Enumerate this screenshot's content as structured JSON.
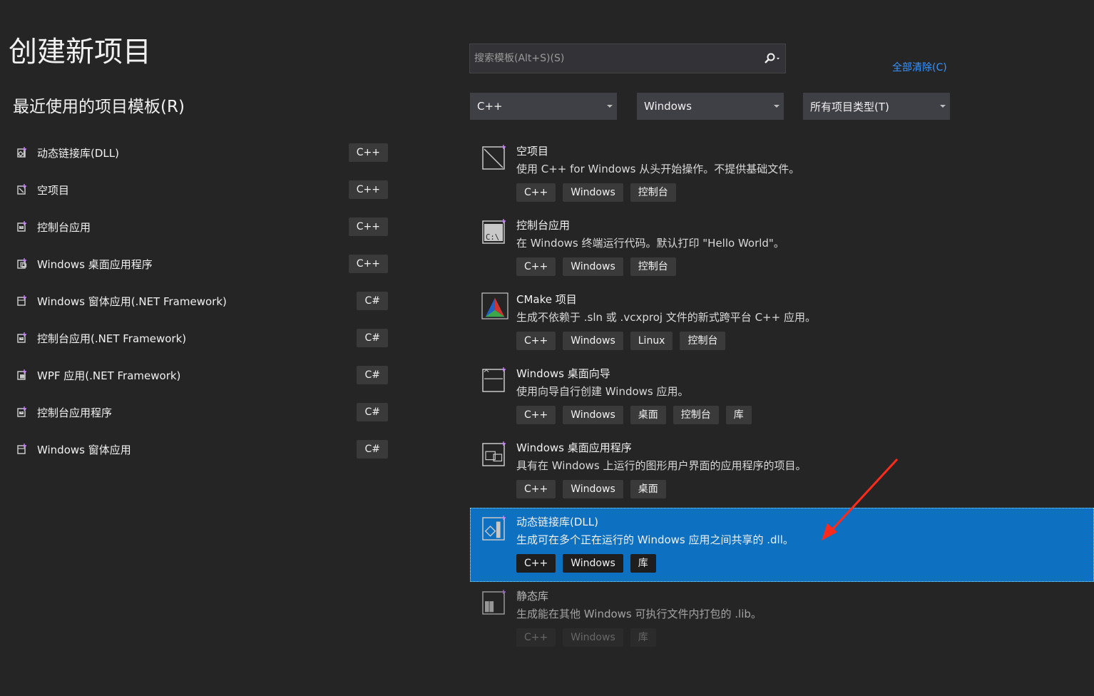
{
  "page": {
    "title": "创建新项目",
    "recent_heading": "最近使用的项目模板(R)"
  },
  "recent": [
    {
      "label": "动态链接库(DLL)",
      "lang": "C++",
      "icon": "dll-icon"
    },
    {
      "label": "空项目",
      "lang": "C++",
      "icon": "empty-project-icon"
    },
    {
      "label": "控制台应用",
      "lang": "C++",
      "icon": "console-app-icon"
    },
    {
      "label": "Windows 桌面应用程序",
      "lang": "C++",
      "icon": "desktop-app-icon"
    },
    {
      "label": "Windows 窗体应用(.NET Framework)",
      "lang": "C#",
      "icon": "winforms-icon"
    },
    {
      "label": "控制台应用(.NET Framework)",
      "lang": "C#",
      "icon": "console-app-icon"
    },
    {
      "label": "WPF 应用(.NET Framework)",
      "lang": "C#",
      "icon": "wpf-icon"
    },
    {
      "label": "控制台应用程序",
      "lang": "C#",
      "icon": "console-app-icon"
    },
    {
      "label": "Windows 窗体应用",
      "lang": "C#",
      "icon": "winforms-icon"
    }
  ],
  "search": {
    "placeholder": "搜索模板(Alt+S)(S)",
    "clear_all": "全部清除(C)"
  },
  "filters": {
    "language": "C++",
    "platform": "Windows",
    "project_type": "所有项目类型(T)"
  },
  "templates": [
    {
      "name": "空项目",
      "desc": "使用 C++ for Windows 从头开始操作。不提供基础文件。",
      "tags": [
        "C++",
        "Windows",
        "控制台"
      ],
      "icon": "empty-project-icon"
    },
    {
      "name": "控制台应用",
      "desc": "在 Windows 终端运行代码。默认打印 \"Hello World\"。",
      "tags": [
        "C++",
        "Windows",
        "控制台"
      ],
      "icon": "console-app-icon"
    },
    {
      "name": "CMake 项目",
      "desc": "生成不依赖于 .sln 或 .vcxproj 文件的新式跨平台 C++ 应用。",
      "tags": [
        "C++",
        "Windows",
        "Linux",
        "控制台"
      ],
      "icon": "cmake-icon"
    },
    {
      "name": "Windows 桌面向导",
      "desc": "使用向导自行创建 Windows 应用。",
      "tags": [
        "C++",
        "Windows",
        "桌面",
        "控制台",
        "库"
      ],
      "icon": "wizard-icon"
    },
    {
      "name": "Windows 桌面应用程序",
      "desc": "具有在 Windows 上运行的图形用户界面的应用程序的项目。",
      "tags": [
        "C++",
        "Windows",
        "桌面"
      ],
      "icon": "desktop-app-icon"
    },
    {
      "name": "动态链接库(DLL)",
      "desc": "生成可在多个正在运行的 Windows 应用之间共享的 .dll。",
      "tags": [
        "C++",
        "Windows",
        "库"
      ],
      "icon": "dll-icon",
      "selected": true
    },
    {
      "name": "静态库",
      "desc": "生成能在其他 Windows 可执行文件内打包的 .lib。",
      "tags": [
        "C++",
        "Windows",
        "库"
      ],
      "icon": "static-lib-icon"
    }
  ],
  "colors": {
    "background": "#252526",
    "selection": "#0e70c0",
    "link": "#3794ff",
    "annotation_arrow": "#ff2a1a"
  }
}
